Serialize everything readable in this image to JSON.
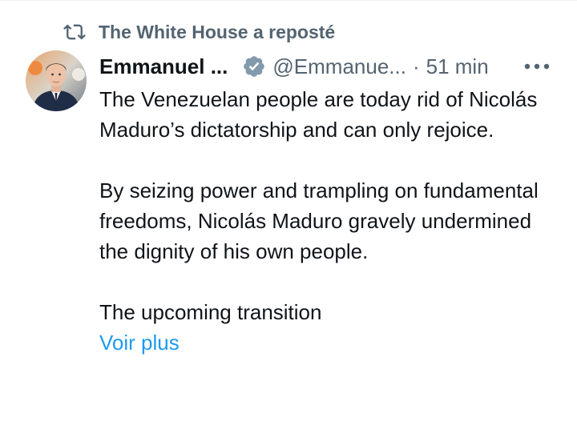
{
  "repost": {
    "label": "The White House a reposté",
    "icon": "repost-icon"
  },
  "author": {
    "name": "Emmanuel ...",
    "handle": "@Emmanue...",
    "verified_icon": "verified-badge-icon",
    "avatar": "avatar-photo"
  },
  "meta": {
    "separator": "·",
    "time": "51 min",
    "more_icon": "more-icon"
  },
  "body": {
    "paragraphs": [
      "The Venezuelan people are today rid of Nicolás Maduro’s dictatorship and can only rejoice.",
      "By seizing power and trampling on fundamental freedoms, Nicolás Maduro gravely undermined the dignity of his own people.",
      "The upcoming transition"
    ],
    "see_more": "Voir plus"
  },
  "colors": {
    "text": "#0f1419",
    "secondary": "#536471",
    "link": "#1d9bf0",
    "verified": "#829aab"
  }
}
